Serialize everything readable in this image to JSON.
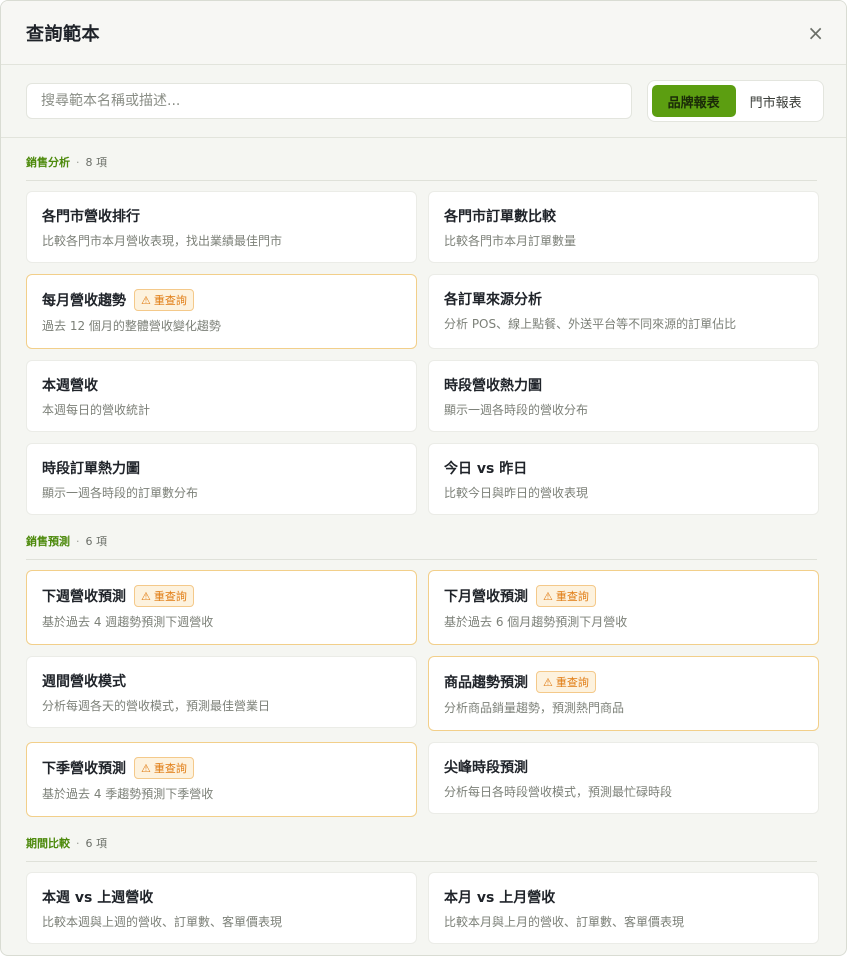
{
  "modal": {
    "title": "查詢範本",
    "close_label": "×"
  },
  "search": {
    "placeholder": "搜尋範本名稱或描述..."
  },
  "toggle": {
    "brand_label": "品牌報表",
    "store_label": "門市報表",
    "selected": "品牌報表"
  },
  "colors": {
    "accent": "#5c9e11",
    "section_label": "#4d8a0c",
    "warning": "#e07a10",
    "warning_border": "#f2cf8a"
  },
  "sections": [
    {
      "name": "銷售分析",
      "sep": "·",
      "count": "8 項",
      "cards": [
        {
          "title": "各門市營收排行",
          "desc": "比較各門市本月營收表現，找出業績最佳門市",
          "badge": ""
        },
        {
          "title": "各門市訂單數比較",
          "desc": "比較各門市本月訂單數量",
          "badge": ""
        },
        {
          "title": "每月營收趨勢",
          "desc": "過去 12 個月的整體營收變化趨勢",
          "badge": "重查詢"
        },
        {
          "title": "各訂單來源分析",
          "desc": "分析 POS、線上點餐、外送平台等不同來源的訂單佔比",
          "badge": ""
        },
        {
          "title": "本週營收",
          "desc": "本週每日的營收統計",
          "badge": ""
        },
        {
          "title": "時段營收熱力圖",
          "desc": "顯示一週各時段的營收分布",
          "badge": ""
        },
        {
          "title": "時段訂單熱力圖",
          "desc": "顯示一週各時段的訂單數分布",
          "badge": ""
        },
        {
          "title": "今日 vs 昨日",
          "desc": "比較今日與昨日的營收表現",
          "badge": ""
        }
      ]
    },
    {
      "name": "銷售預測",
      "sep": "·",
      "count": "6 項",
      "cards": [
        {
          "title": "下週營收預測",
          "desc": "基於過去 4 週趨勢預測下週營收",
          "badge": "重查詢"
        },
        {
          "title": "下月營收預測",
          "desc": "基於過去 6 個月趨勢預測下月營收",
          "badge": "重查詢"
        },
        {
          "title": "週間營收模式",
          "desc": "分析每週各天的營收模式，預測最佳營業日",
          "badge": ""
        },
        {
          "title": "商品趨勢預測",
          "desc": "分析商品銷量趨勢，預測熱門商品",
          "badge": "重查詢"
        },
        {
          "title": "下季營收預測",
          "desc": "基於過去 4 季趨勢預測下季營收",
          "badge": "重查詢"
        },
        {
          "title": "尖峰時段預測",
          "desc": "分析每日各時段營收模式，預測最忙碌時段",
          "badge": ""
        }
      ]
    },
    {
      "name": "期間比較",
      "sep": "·",
      "count": "6 項",
      "cards": [
        {
          "title": "本週 vs 上週營收",
          "desc": "比較本週與上週的營收、訂單數、客單價表現",
          "badge": ""
        },
        {
          "title": "本月 vs 上月營收",
          "desc": "比較本月與上月的營收、訂單數、客單價表現",
          "badge": ""
        }
      ]
    }
  ],
  "badge_icon": "⚠"
}
